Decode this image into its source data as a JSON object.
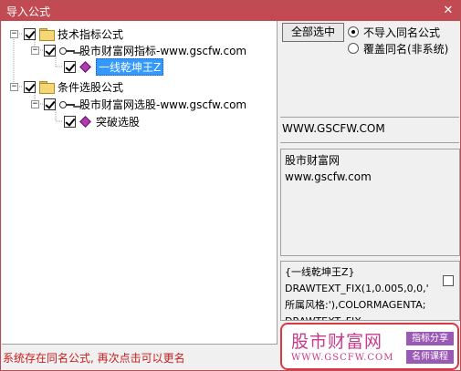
{
  "window": {
    "title": "导入公式",
    "close_glyph": "✕"
  },
  "tree": {
    "groups": [
      {
        "label": "技术指标公式",
        "checked": true,
        "expanded": true,
        "icon": "folder-icon",
        "children": [
          {
            "label": "股市财富网指标-www.gscfw.com",
            "checked": true,
            "icon": "key-icon",
            "children": [
              {
                "label": "一线乾坤王Z",
                "checked": true,
                "icon": "diamond-icon",
                "selected": true
              }
            ]
          }
        ]
      },
      {
        "label": "条件选股公式",
        "checked": true,
        "expanded": true,
        "icon": "folder-icon",
        "children": [
          {
            "label": "股市财富网选股-www.gscfw.com",
            "checked": true,
            "icon": "key-icon",
            "children": [
              {
                "label": "突破选股",
                "checked": true,
                "icon": "diamond-icon",
                "selected": false
              }
            ]
          }
        ]
      }
    ]
  },
  "controls": {
    "select_all_label": "全部选中",
    "radio_options": [
      {
        "label": "不导入同名公式",
        "selected": true
      },
      {
        "label": "覆盖同名(非系统)",
        "selected": false
      }
    ]
  },
  "info": {
    "site": "WWW.GSCFW.COM",
    "desc_line1": "股市财富网",
    "desc_line2": "www.gscfw.com",
    "code_lines": [
      "{一线乾坤王Z}",
      "DRAWTEXT_FIX(1,0.005,0,0,'",
      "所属风格:'),COLORMAGENTA;",
      "DRAWTEXT_FIX"
    ]
  },
  "status": {
    "message": "系统存在同名公式, 再次点击可以更名",
    "color": "#c81e1e"
  },
  "watermark": {
    "title": "股市财富网",
    "url": "WWW.GSCFW.COM",
    "tag1": "指标分享",
    "tag2": "名师课程"
  },
  "colors": {
    "titlebar": "#c24b53",
    "selection": "#3399ff",
    "watermark_text": "#c93a8a",
    "tag_bg": "#9b59b6"
  }
}
